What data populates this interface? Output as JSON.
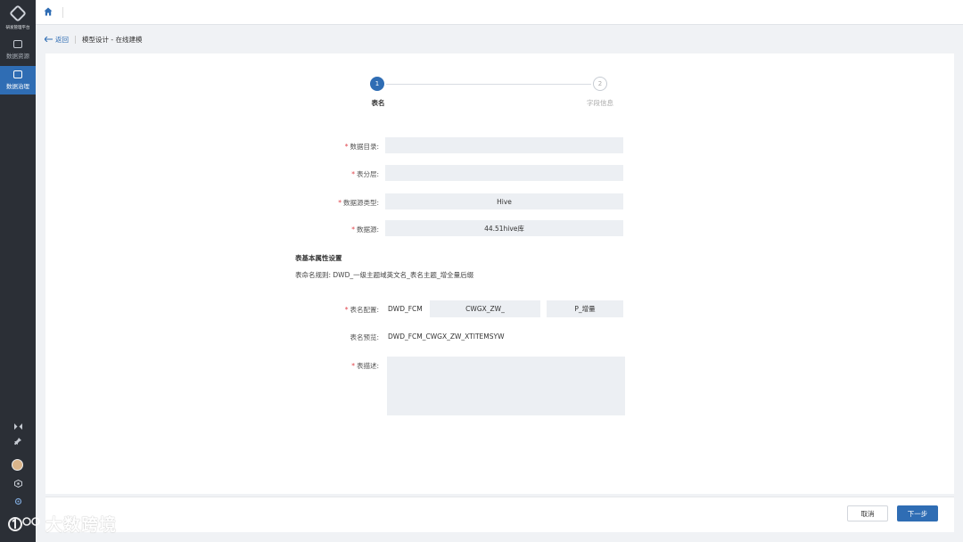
{
  "sidebar": {
    "logo_text": "研发管理平台",
    "items": [
      {
        "label": "数据资源",
        "icon": "monitor-icon"
      },
      {
        "label": "数据治理",
        "icon": "document-icon"
      }
    ],
    "tools": [
      "collapse-icon",
      "pin-icon",
      "avatar",
      "settings-cube-icon",
      "gear-icon"
    ]
  },
  "topbar": {
    "home_icon": "home-icon"
  },
  "breadcrumb": {
    "back": "返回",
    "title": "模型设计 - 在线建模"
  },
  "steps": [
    {
      "num": "1",
      "label": "表名"
    },
    {
      "num": "2",
      "label": "字段信息"
    }
  ],
  "form": {
    "catalog_label": "数据目录:",
    "catalog_value": "",
    "layer_label": "表分层:",
    "layer_value": "",
    "source_type_label": "数据源类型:",
    "source_type_value": "Hive",
    "source_label": "数据源:",
    "source_value": "44.51hive库",
    "section_title": "表基本属性设置",
    "rule_text": "表命名规则: DWD_一级主题域英文名_表名主题_增全量后缀",
    "name_config_label": "表名配置:",
    "name_prefix": "DWD_FCM",
    "name_middle": "CWGX_ZW_",
    "name_suffix": "P_增量",
    "preview_label": "表名预览:",
    "preview_value": "DWD_FCM_CWGX_ZW_XTITEMSYW",
    "desc_label": "表描述:",
    "desc_value": ""
  },
  "footer": {
    "cancel": "取消",
    "next": "下一步"
  },
  "watermark": {
    "text": "大数跨境"
  }
}
